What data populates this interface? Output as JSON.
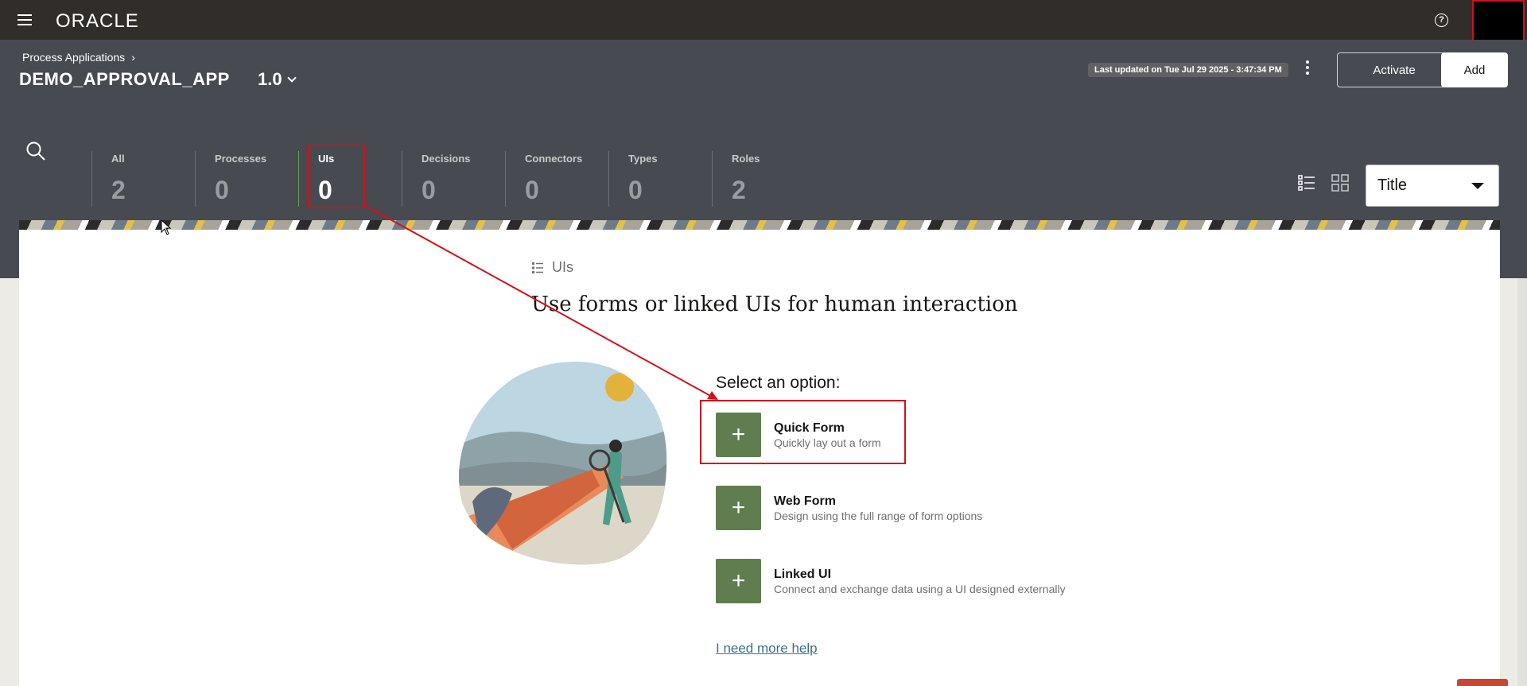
{
  "topbar": {
    "logo": "ORACLE",
    "help_icon": "?"
  },
  "header": {
    "breadcrumb": "Process Applications",
    "app_title": "DEMO_APPROVAL_APP",
    "version": "1.0",
    "last_updated": "Last updated on Tue Jul 29 2025 - 3:47:34 PM",
    "activate_label": "Activate",
    "add_label": "Add"
  },
  "stats": [
    {
      "label": "All",
      "value": "2"
    },
    {
      "label": "Processes",
      "value": "0"
    },
    {
      "label": "UIs",
      "value": "0"
    },
    {
      "label": "Decisions",
      "value": "0"
    },
    {
      "label": "Connectors",
      "value": "0"
    },
    {
      "label": "Types",
      "value": "0"
    },
    {
      "label": "Roles",
      "value": "2"
    }
  ],
  "sort": {
    "selected": "Title"
  },
  "main": {
    "section_tag": "UIs",
    "title": "Use forms or linked UIs for human interaction",
    "select_label": "Select an option:",
    "options": [
      {
        "title": "Quick Form",
        "desc": "Quickly lay out a form"
      },
      {
        "title": "Web Form",
        "desc": "Design using the full range of form options"
      },
      {
        "title": "Linked UI",
        "desc": "Connect and exchange data using a UI designed externally"
      }
    ],
    "help_link": "I need more help"
  },
  "icons": {
    "plus": "+"
  },
  "colors": {
    "topbar": "#312d2a",
    "header": "#474a50",
    "option_button": "#5f7d4f",
    "annotation": "#d1121a"
  }
}
